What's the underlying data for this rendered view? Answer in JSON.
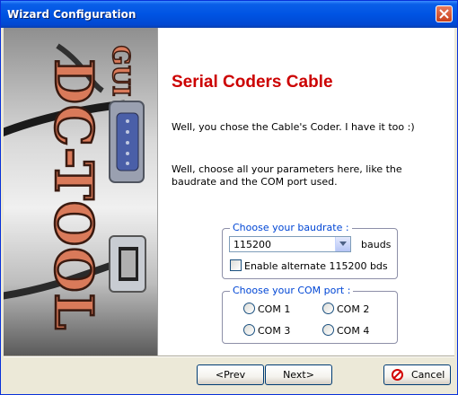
{
  "window": {
    "title": "Wizard Configuration"
  },
  "banner": {
    "logo_text": "DC-TOOL",
    "logo_subtext": "GUI"
  },
  "page": {
    "heading": "Serial Coders Cable",
    "para1": "Well, you chose the Cable's Coder. I have it too :)",
    "para2": "Well, choose all your parameters here, like the baudrate and the COM port used."
  },
  "baudrate": {
    "legend": "Choose your baudrate :",
    "selected": "115200",
    "unit": "bauds",
    "alt_checkbox_label": "Enable alternate 115200 bds",
    "alt_checked": false
  },
  "com": {
    "legend": "Choose your COM port :",
    "options": [
      "COM 1",
      "COM 2",
      "COM 3",
      "COM 4"
    ],
    "selected": null
  },
  "buttons": {
    "prev": "<Prev",
    "next": "Next>",
    "cancel": "Cancel"
  },
  "colors": {
    "heading": "#cc0000",
    "legend": "#0046d5",
    "titlebar": "#0054e3"
  }
}
